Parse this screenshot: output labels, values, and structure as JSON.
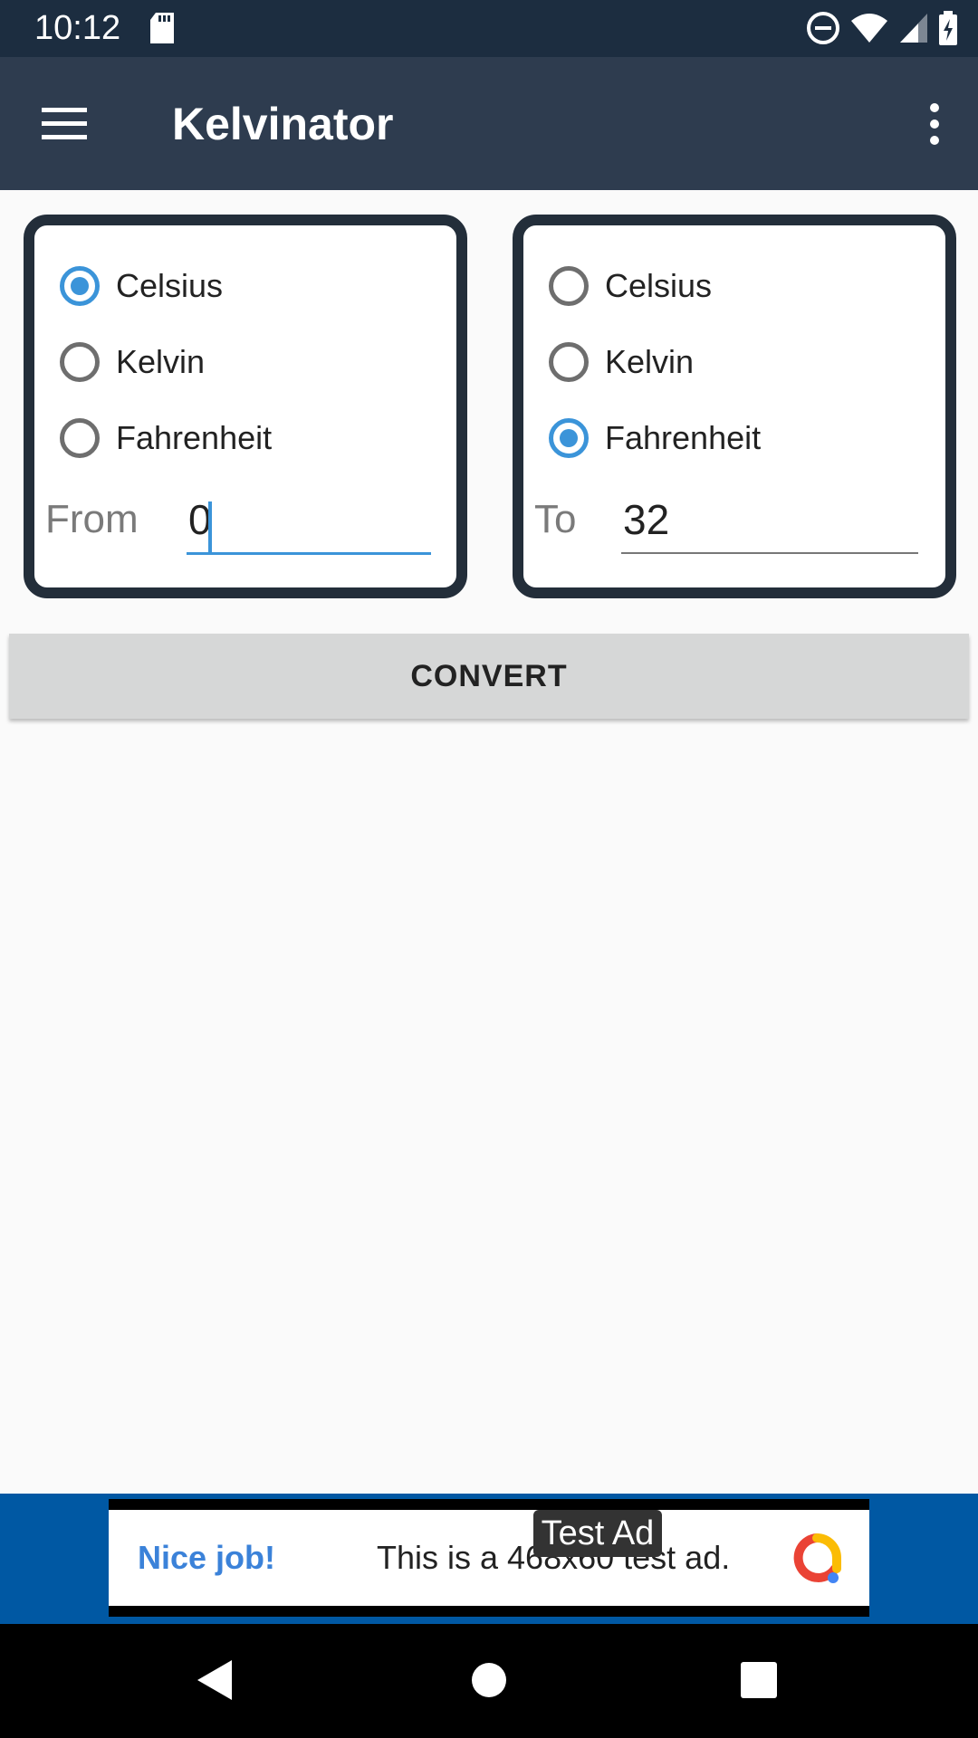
{
  "status_bar": {
    "time": "10:12"
  },
  "app_bar": {
    "title": "Kelvinator"
  },
  "from_card": {
    "options": [
      {
        "label": "Celsius",
        "checked": true
      },
      {
        "label": "Kelvin",
        "checked": false
      },
      {
        "label": "Fahrenheit",
        "checked": false
      }
    ],
    "field_label": "From",
    "value": "0"
  },
  "to_card": {
    "options": [
      {
        "label": "Celsius",
        "checked": false
      },
      {
        "label": "Kelvin",
        "checked": false
      },
      {
        "label": "Fahrenheit",
        "checked": true
      }
    ],
    "field_label": "To",
    "value": "32"
  },
  "convert_button": {
    "label": "CONVERT"
  },
  "ad": {
    "badge": "Test Ad",
    "headline": "Nice job!",
    "text": "This is a 468x60 test ad."
  },
  "colors": {
    "status_bar": "#1c2d40",
    "app_bar": "#2e3c4f",
    "accent": "#3b94d9",
    "card_border": "#232e3a",
    "ad_background": "#0058a3"
  }
}
